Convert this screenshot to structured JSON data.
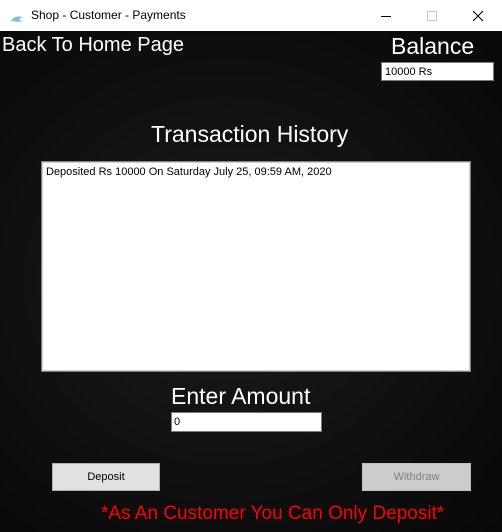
{
  "window": {
    "title": "Shop - Customer - Payments",
    "minimize_symbol": "─",
    "maximize_symbol": "☐",
    "close_symbol": "✕"
  },
  "nav": {
    "back_label": "Back To Home Page"
  },
  "balance": {
    "label": "Balance",
    "value": "10000 Rs"
  },
  "history": {
    "title": "Transaction History",
    "items": [
      "Deposited Rs 10000 On Saturday July 25, 09:59 AM, 2020"
    ]
  },
  "amount": {
    "label": "Enter Amount",
    "value": "0"
  },
  "actions": {
    "deposit_label": "Deposit",
    "withdraw_label": "Withdraw",
    "withdraw_enabled": false
  },
  "notice": {
    "text": "*As An Customer You Can Only Deposit*",
    "color": "#ff0000"
  },
  "colors": {
    "background": "#111111",
    "text": "#ffffff",
    "app_icon": "#66b2c8"
  },
  "icons": {
    "app": "app-icon",
    "minimize": "minimize-icon",
    "maximize": "maximize-icon",
    "close": "close-icon"
  }
}
